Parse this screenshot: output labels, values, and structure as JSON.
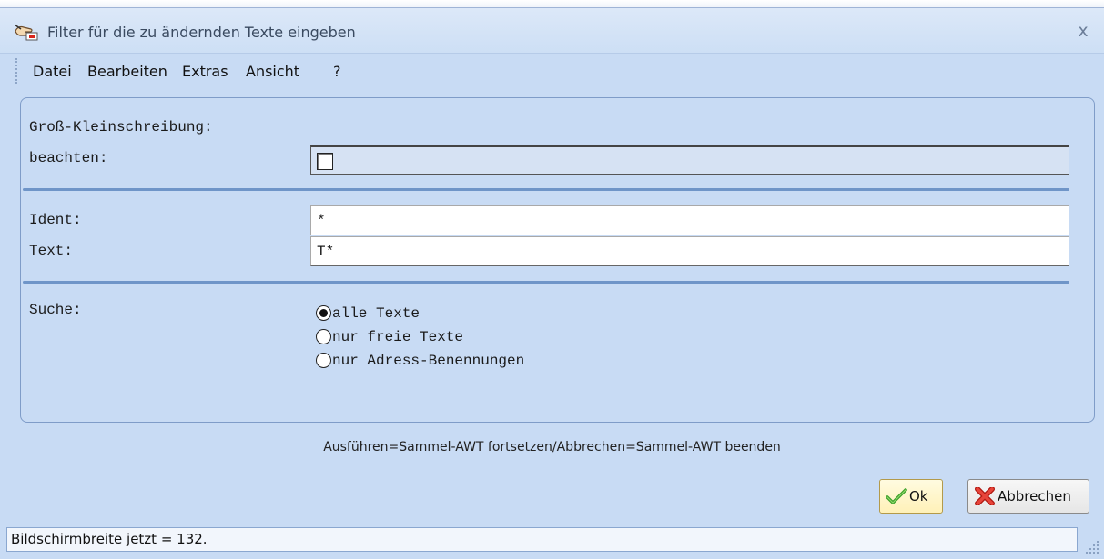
{
  "window": {
    "title": "Filter für die zu ändernden Texte eingeben",
    "close_glyph": "x"
  },
  "menu": {
    "items": [
      "Datei",
      "Bearbeiten",
      "Extras",
      "Ansicht",
      "?"
    ]
  },
  "form": {
    "case_label_line1": "Groß-Kleinschreibung:",
    "case_label_line2": "beachten:",
    "case_checked": false,
    "ident_label": "Ident:",
    "ident_value": "*",
    "text_label": "Text:",
    "text_value": "T*",
    "search_label": "Suche:",
    "search_options": [
      "alle Texte",
      "nur freie Texte",
      "nur Adress-Benennungen"
    ],
    "search_selected_index": 0
  },
  "hint": "Ausführen=Sammel-AWT fortsetzen/Abbrechen=Sammel-AWT beenden",
  "buttons": {
    "ok_label": "Ok",
    "cancel_label": "Abbrechen"
  },
  "status": {
    "text": "Bildschirmbreite jetzt = 132."
  },
  "icons": {
    "app": "hand-pen-icon",
    "ok": "checkmark-icon",
    "cancel": "red-x-icon"
  },
  "colors": {
    "background": "#c8dbf4",
    "separator": "#6f95c8",
    "ok_check": "#3aa12a",
    "cancel_x": "#d9261c"
  }
}
